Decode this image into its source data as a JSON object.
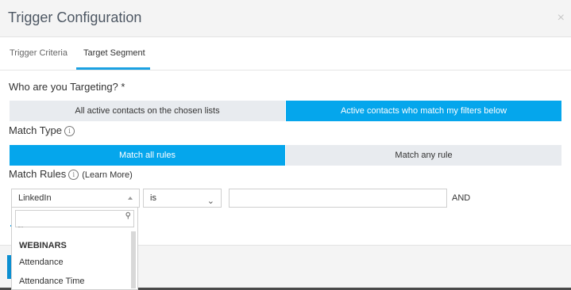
{
  "dialog": {
    "title": "Trigger Configuration",
    "close_icon": "×"
  },
  "tabs": [
    {
      "label": "Trigger Criteria",
      "active": false
    },
    {
      "label": "Target Segment",
      "active": true
    }
  ],
  "targeting": {
    "label": "Who are you Targeting? *",
    "options": [
      "All active contacts on the chosen lists",
      "Active contacts who match my filters below"
    ],
    "selected": 1
  },
  "match_type": {
    "label": "Match Type",
    "info_icon": "i",
    "options": [
      "Match all rules",
      "Match any rule"
    ],
    "selected": 0
  },
  "match_rules": {
    "label": "Match Rules",
    "info_icon": "i",
    "learn_more": "(Learn More)",
    "rule": {
      "field": "LinkedIn",
      "operator": "is",
      "value": "",
      "conjunction": "AND"
    }
  },
  "dropdown": {
    "search_value": "",
    "search_icon": "⚲",
    "group_label": "WEBINARS",
    "items": [
      "Attendance",
      "Attendance Time"
    ]
  },
  "colors": {
    "accent": "#05a6ec",
    "tab_underline": "#1ba1e2",
    "segment_inactive": "#e8ebef"
  }
}
